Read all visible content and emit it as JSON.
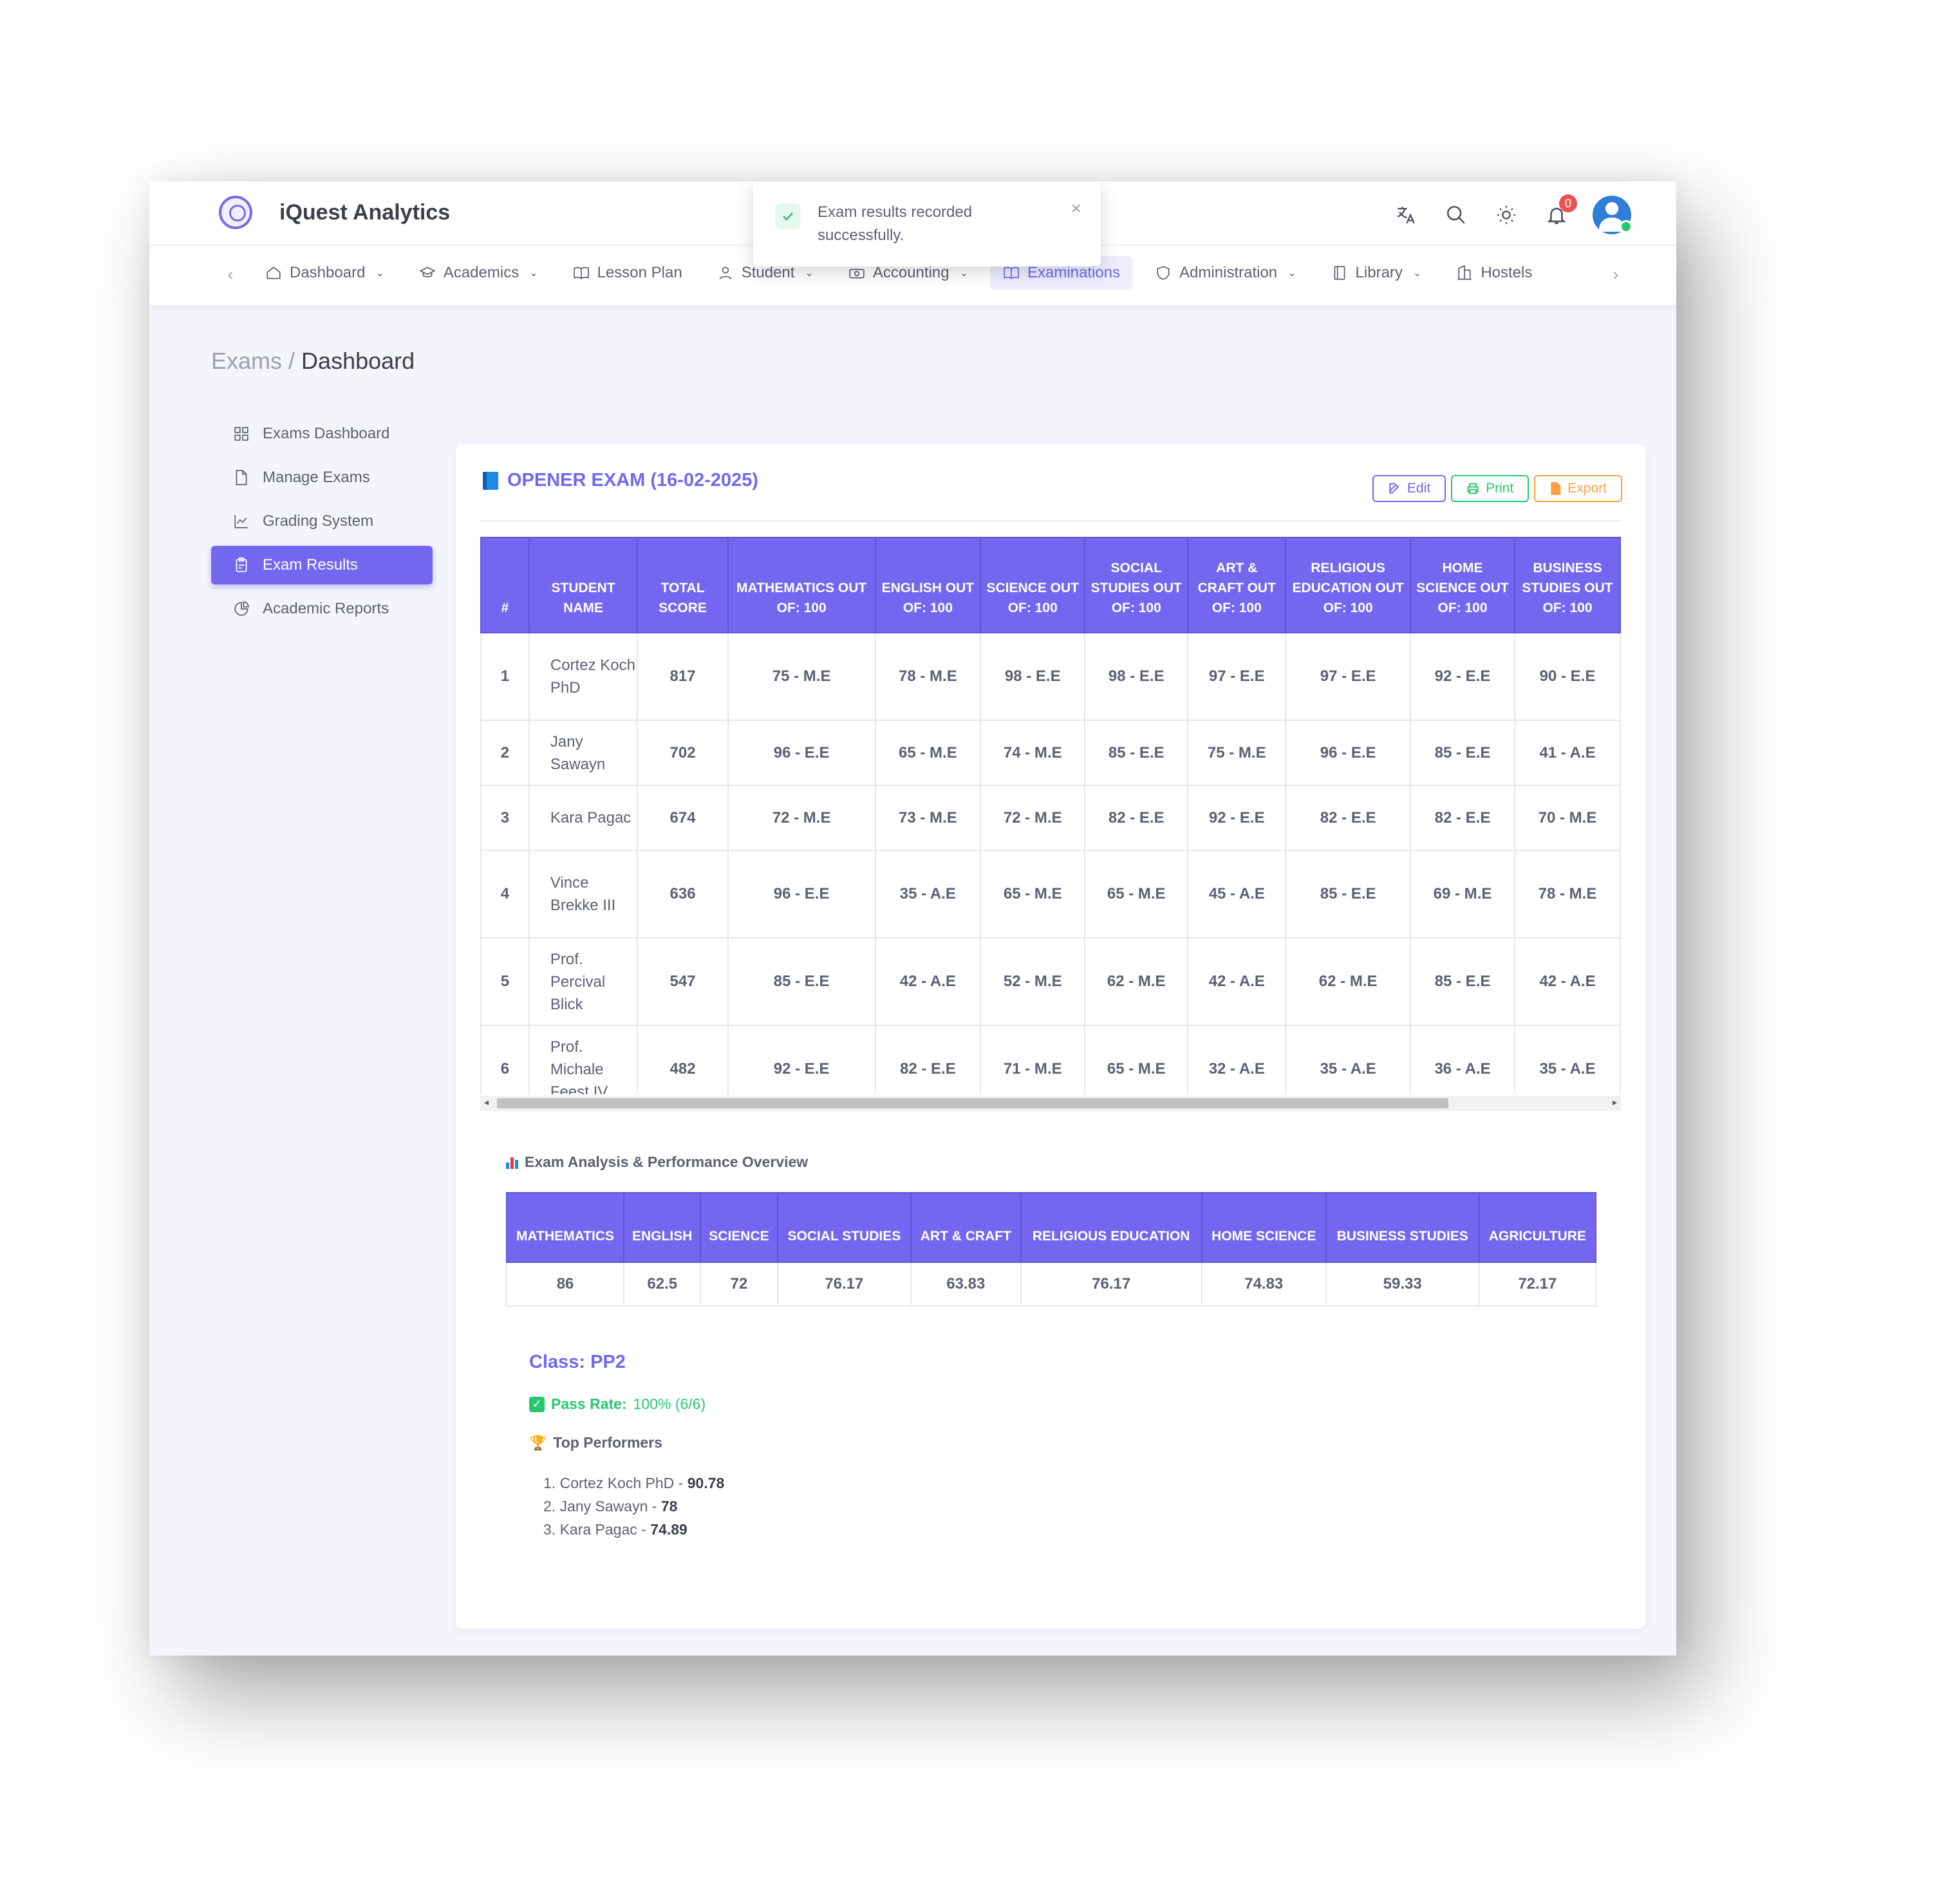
{
  "app": {
    "name": "iQuest Analytics",
    "notification_count": "0"
  },
  "toast": {
    "message": "Exam results recorded successfully.",
    "close": "×"
  },
  "nav": [
    {
      "label": "Dashboard",
      "icon": "home-icon",
      "dropdown": true
    },
    {
      "label": "Academics",
      "icon": "graduation-cap-icon",
      "dropdown": true
    },
    {
      "label": "Lesson Plan",
      "icon": "book-open-icon",
      "dropdown": false
    },
    {
      "label": "Student",
      "icon": "user-icon",
      "dropdown": true
    },
    {
      "label": "Accounting",
      "icon": "money-icon",
      "dropdown": true
    },
    {
      "label": "Examinations",
      "icon": "book-open-icon",
      "dropdown": false,
      "active": true
    },
    {
      "label": "Administration",
      "icon": "shield-icon",
      "dropdown": true
    },
    {
      "label": "Library",
      "icon": "notebook-icon",
      "dropdown": true
    },
    {
      "label": "Hostels",
      "icon": "building-icon",
      "dropdown": false
    }
  ],
  "breadcrumb": {
    "parent": "Exams /",
    "current": "Dashboard"
  },
  "sidebar": [
    {
      "label": "Exams Dashboard",
      "icon": "grid-icon"
    },
    {
      "label": "Manage Exams",
      "icon": "file-icon"
    },
    {
      "label": "Grading System",
      "icon": "chart-icon"
    },
    {
      "label": "Exam Results",
      "icon": "clipboard-icon",
      "active": true
    },
    {
      "label": "Academic Reports",
      "icon": "pie-chart-icon"
    }
  ],
  "exam": {
    "title": "OPENER EXAM (16-02-2025)",
    "actions": {
      "edit": "Edit",
      "print": "Print",
      "export": "Export"
    },
    "headers": [
      "#",
      "STUDENT NAME",
      "TOTAL SCORE",
      "MATHEMATICS OUT OF: 100",
      "ENGLISH OUT OF: 100",
      "SCIENCE OUT OF: 100",
      "SOCIAL STUDIES OUT OF: 100",
      "ART & CRAFT OUT OF: 100",
      "RELIGIOUS EDUCATION OUT OF: 100",
      "HOME SCIENCE OUT OF: 100",
      "BUSINESS STUDIES OUT OF: 100"
    ],
    "rows": [
      {
        "n": "1",
        "name": "Cortez Koch PhD",
        "total": "817",
        "scores": [
          "75 - M.E",
          "78 - M.E",
          "98 - E.E",
          "98 - E.E",
          "97 - E.E",
          "97 - E.E",
          "92 - E.E",
          "90 - E.E"
        ]
      },
      {
        "n": "2",
        "name": "Jany Sawayn",
        "total": "702",
        "scores": [
          "96 - E.E",
          "65 - M.E",
          "74 - M.E",
          "85 - E.E",
          "75 - M.E",
          "96 - E.E",
          "85 - E.E",
          "41 - A.E"
        ]
      },
      {
        "n": "3",
        "name": "Kara Pagac",
        "total": "674",
        "scores": [
          "72 - M.E",
          "73 - M.E",
          "72 - M.E",
          "82 - E.E",
          "92 - E.E",
          "82 - E.E",
          "82 - E.E",
          "70 - M.E"
        ]
      },
      {
        "n": "4",
        "name": "Vince Brekke III",
        "total": "636",
        "scores": [
          "96 - E.E",
          "35 - A.E",
          "65 - M.E",
          "65 - M.E",
          "45 - A.E",
          "85 - E.E",
          "69 - M.E",
          "78 - M.E"
        ]
      },
      {
        "n": "5",
        "name": "Prof. Percival Blick",
        "total": "547",
        "scores": [
          "85 - E.E",
          "42 - A.E",
          "52 - M.E",
          "62 - M.E",
          "42 - A.E",
          "62 - M.E",
          "85 - E.E",
          "42 - A.E"
        ]
      },
      {
        "n": "6",
        "name": "Prof. Michale Feest IV",
        "total": "482",
        "scores": [
          "92 - E.E",
          "82 - E.E",
          "71 - M.E",
          "65 - M.E",
          "32 - A.E",
          "35 - A.E",
          "36 - A.E",
          "35 - A.E"
        ]
      }
    ]
  },
  "analysis": {
    "title": "Exam Analysis & Performance Overview",
    "headers": [
      "MATHEMATICS",
      "ENGLISH",
      "SCIENCE",
      "SOCIAL STUDIES",
      "ART & CRAFT",
      "RELIGIOUS EDUCATION",
      "HOME SCIENCE",
      "BUSINESS STUDIES",
      "AGRICULTURE"
    ],
    "values": [
      "86",
      "62.5",
      "72",
      "76.17",
      "63.83",
      "76.17",
      "74.83",
      "59.33",
      "72.17"
    ]
  },
  "class_summary": {
    "class_label": "Class: PP2",
    "pass_rate_label": "Pass Rate:",
    "pass_rate_value": "100% (6/6)",
    "top_title": "Top Performers",
    "top": [
      {
        "name": "Cortez Koch PhD",
        "score": "90.78"
      },
      {
        "name": "Jany Sawayn",
        "score": "78"
      },
      {
        "name": "Kara Pagac",
        "score": "74.89"
      }
    ]
  },
  "colors": {
    "accent": "#7367f0",
    "ee": "#28c76f",
    "me": "#7367f0",
    "ae": "#ff9f43"
  }
}
